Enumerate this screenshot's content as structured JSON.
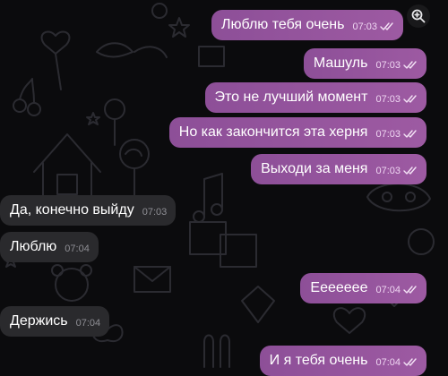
{
  "chat": {
    "messages": [
      {
        "text": "Люблю тебя очень",
        "time": "07:03",
        "direction": "outgoing",
        "status": "read"
      },
      {
        "text": "Машуль",
        "time": "07:03",
        "direction": "outgoing",
        "status": "read"
      },
      {
        "text": "Это не лучший момент",
        "time": "07:03",
        "direction": "outgoing",
        "status": "read"
      },
      {
        "text": "Но как закончится эта херня",
        "time": "07:03",
        "direction": "outgoing",
        "status": "read"
      },
      {
        "text": "Выходи за меня",
        "time": "07:03",
        "direction": "outgoing",
        "status": "read"
      },
      {
        "text": "Да, конечно выйду",
        "time": "07:03",
        "direction": "incoming"
      },
      {
        "text": "Люблю",
        "time": "07:04",
        "direction": "incoming"
      },
      {
        "text": "Ееееееe",
        "time": "07:04",
        "direction": "outgoing",
        "status": "read"
      },
      {
        "text": "Держись",
        "time": "07:04",
        "direction": "incoming"
      },
      {
        "text": "И я тебя очень",
        "time": "07:04",
        "direction": "outgoing",
        "status": "read"
      }
    ]
  },
  "icons": {
    "zoom": "zoom-in-icon",
    "read_status": "double-check-icon"
  },
  "colors": {
    "background": "#0b0b0d",
    "outgoing_bubble": "#9454a0",
    "incoming_bubble": "#2a2a2d",
    "text": "#ffffff"
  }
}
